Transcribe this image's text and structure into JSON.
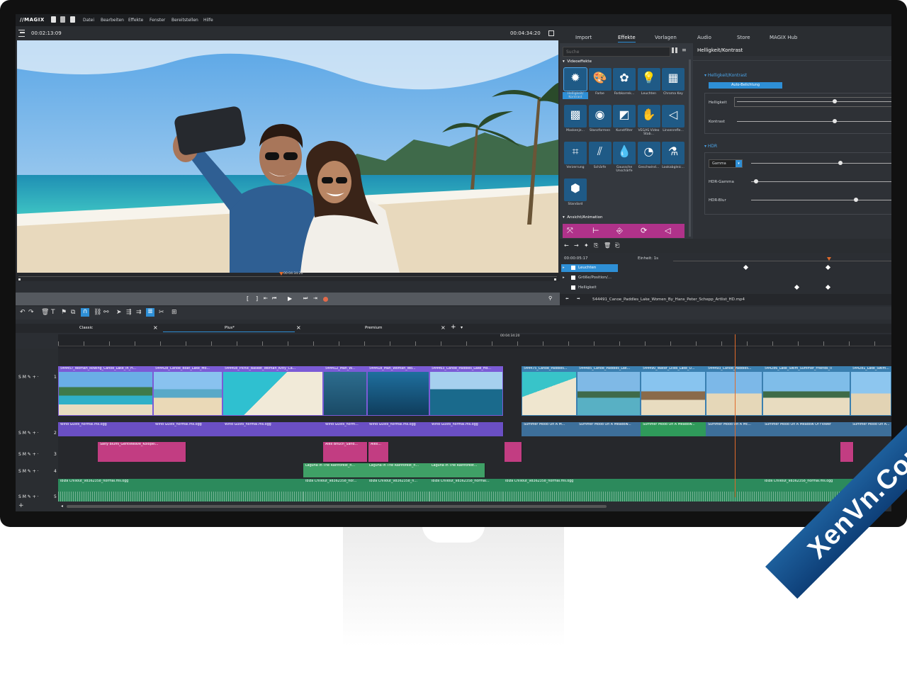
{
  "app": {
    "logo": "//MAGIX"
  },
  "menu": {
    "items": [
      "Datei",
      "Bearbeiten",
      "Effekte",
      "Fenster",
      "Bereitstellen",
      "Hilfe"
    ]
  },
  "preview": {
    "time_left": "00:02:13:09",
    "time_right": "00:04:34:20",
    "marker_time": "00:04:34:20"
  },
  "right_tabs": [
    "Import",
    "Effekte",
    "Vorlagen",
    "Audio",
    "Store",
    "MAGIX Hub"
  ],
  "effects": {
    "search_placeholder": "Suche",
    "section_video": "Videoeffekte",
    "section_anim": "Ansicht/Animation",
    "tiles": [
      {
        "label": "Helligkeit/ Kontrast",
        "icon": "sun-icon"
      },
      {
        "label": "Farbe",
        "icon": "palette-icon"
      },
      {
        "label": "Farbkorrek...",
        "icon": "color-correction-icon"
      },
      {
        "label": "Leuchten",
        "icon": "glow-icon"
      },
      {
        "label": "Chroma Key",
        "icon": "chroma-key-icon"
      },
      {
        "label": "Maskenje...",
        "icon": "mask-icon"
      },
      {
        "label": "Stanzformen",
        "icon": "stamp-shapes-icon"
      },
      {
        "label": "Kunstfilter",
        "icon": "art-filter-icon"
      },
      {
        "label": "VEGAS Video Stab...",
        "icon": "stabilizer-icon"
      },
      {
        "label": "Linsenrefle...",
        "icon": "lens-flare-icon"
      },
      {
        "label": "Verzerrung",
        "icon": "distortion-icon"
      },
      {
        "label": "Schärfe",
        "icon": "sharpness-icon"
      },
      {
        "label": "Gaussche Unschärfe",
        "icon": "blur-icon"
      },
      {
        "label": "Geschwind...",
        "icon": "speed-icon"
      },
      {
        "label": "Lookabgleic...",
        "icon": "look-match-icon"
      },
      {
        "label": "Standard",
        "icon": "hexagon-icon"
      }
    ]
  },
  "props": {
    "title": "Helligkeit/Kontrast",
    "section1": "Helligkeit/Kontrast",
    "auto_button": "Auto-Belichtung",
    "brightness_label": "Helligkeit",
    "contrast_label": "Kontrast",
    "section2": "HDR",
    "gamma_select": "Gamma",
    "hdr_gamma_label": "HDR-Gamma",
    "hdr_blur_label": "HDR-Blur",
    "brightness_value": 0.62,
    "contrast_value": 0.62,
    "gamma_value": 0.62,
    "hdr_gamma_value": 0.02,
    "hdr_blur_value": 0.73
  },
  "keyframes": {
    "time": "00:00:05:17",
    "unit": "Einheit: 1s",
    "rows": [
      "Leuchten",
      "Größe/Position/...",
      "Helligkeit"
    ],
    "file": "544491_Canoe_Paddles_Lake_Women_By_Hans_Peter_Schepp_Artlist_HD.mp4"
  },
  "timeline": {
    "tabs": [
      "Classic",
      "Plus*",
      "Premium"
    ],
    "ruler_marker": "00:04:34:20",
    "track_numbers": [
      "1",
      "2",
      "3",
      "4",
      "5"
    ],
    "video_clips": [
      "544457_Woman_Rowing_Canoe_Lake_In_H...",
      "544428_Canoe_Boat_Lake_Mo...",
      "544408_Picnic_Basket_Woman_Kitty_Ca...",
      "544412_Man_W...",
      "544418_Man_Woman_Wo...",
      "544463_Canoe_Paddles_Lake_Hd...",
      "544475_Canoe_Paddles...",
      "544485_Canoe_Paddles_Lak...",
      "544490_Water_Lilies_Lake_U...",
      "544493_Canoe_Paddles...",
      "544286_Lake_Swim_Summer_Friends_II",
      "544281_Lake_Swim..."
    ],
    "audio_clips_a": [
      "Wind Gusts_normal.ms.ogg",
      "Wind Gusts_normal.ms.ogg",
      "Wind Gusts_normal.ms.ogg",
      "Wind Gusts_norm...",
      "Wind Gusts_normal.ms.ogg",
      "Wind Gusts_normal.ms.ogg"
    ],
    "audio_clips_b": [
      "Summer Mood On A M...",
      "Summer Mood On A Meadow...",
      "Summer Mood On A Meadow...",
      "Summer Mood On A Mc...",
      "Summer Mood On A Meadow Of Flower",
      "Summer Mood On A..."
    ],
    "pink_clips": [
      "Salty Bluffs_Gentlewave_Kolopel...",
      "Alex Bnuch_Sand...",
      "Alex..."
    ],
    "lagoon_clips": [
      "Laguna In The Rainforest_n...",
      "Laguna In The Rainforest_n...",
      "Laguna In The Rainforest..."
    ],
    "music_clips": [
      "Ibiza Chillout_98362358_normal.ms.ogg",
      "Ibiza Chillout_98362358_nor...",
      "Ibiza Chillout_98362358_n...",
      "Ibiza Chillout_98362358_normal...",
      "Ibiza Chillout_98362358_normal.ms.ogg",
      "Ibiza Chillout_98362358_normal.ms.ogg"
    ]
  },
  "watermark": "XenVn.Com",
  "colors": {
    "accent": "#2e8fd6",
    "video_clip": "#7b5bd6",
    "audio_green": "#3fb07a",
    "pink": "#d64b8f"
  }
}
